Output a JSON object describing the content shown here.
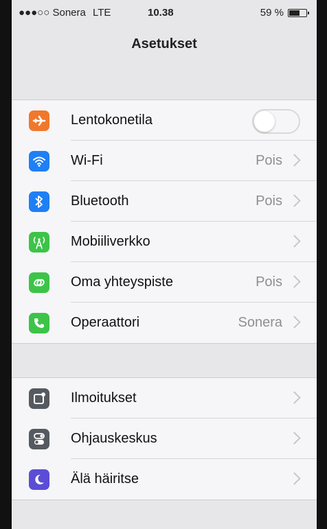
{
  "status_bar": {
    "carrier": "●●●○○ Sonera",
    "network": "LTE",
    "time": "10.38",
    "battery_text": "59 %",
    "battery_level": 0.59
  },
  "nav": {
    "title": "Asetukset"
  },
  "colors": {
    "airplane": "#f0782c",
    "wifi": "#1f7ff5",
    "bluetooth": "#1f7ff5",
    "mobile": "#3cc448",
    "hotspot": "#3cc448",
    "carrier": "#3cc448",
    "notifications": "#555a60",
    "control": "#555a60",
    "dnd": "#5b4dd6"
  },
  "group1": [
    {
      "label": "Lentokonetila",
      "value": "",
      "icon": "airplane-icon",
      "toggle": false
    },
    {
      "label": "Wi-Fi",
      "value": "Pois",
      "icon": "wifi-icon"
    },
    {
      "label": "Bluetooth",
      "value": "Pois",
      "icon": "bluetooth-icon"
    },
    {
      "label": "Mobiiliverkko",
      "value": "",
      "icon": "cellular-icon"
    },
    {
      "label": "Oma yhteyspiste",
      "value": "Pois",
      "icon": "hotspot-icon"
    },
    {
      "label": "Operaattori",
      "value": "Sonera",
      "icon": "phone-icon"
    }
  ],
  "group2": [
    {
      "label": "Ilmoitukset",
      "value": "",
      "icon": "notifications-icon"
    },
    {
      "label": "Ohjauskeskus",
      "value": "",
      "icon": "control-center-icon"
    },
    {
      "label": "Älä häiritse",
      "value": "",
      "icon": "moon-icon"
    }
  ]
}
